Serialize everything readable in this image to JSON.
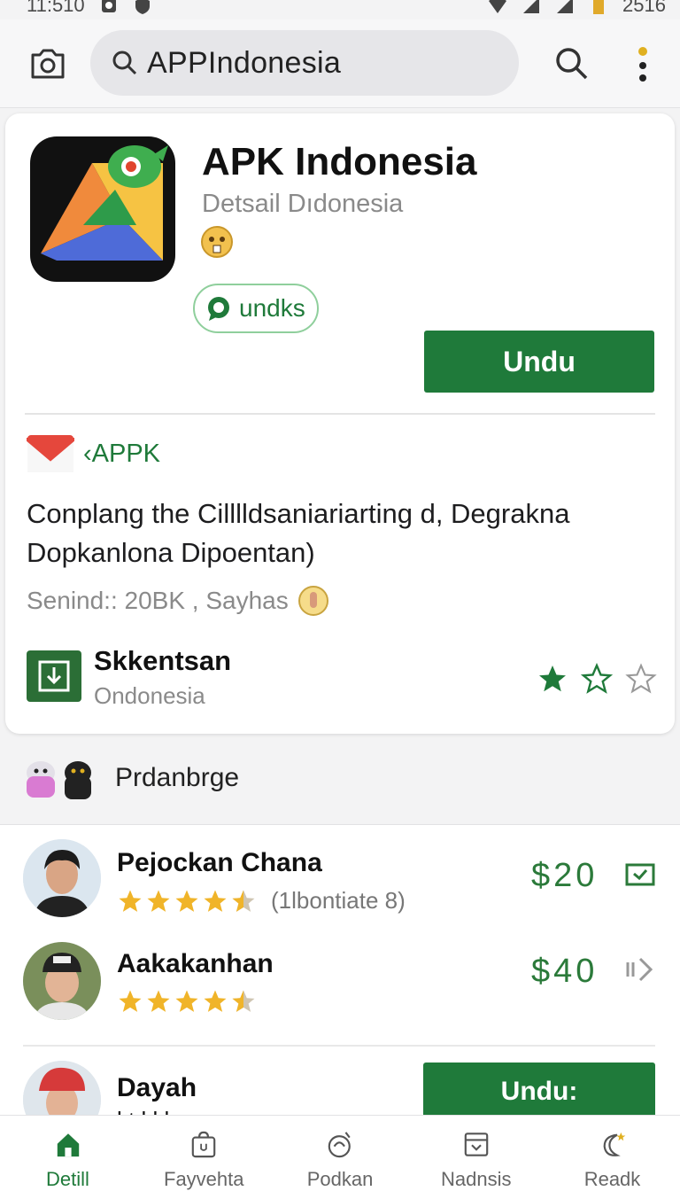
{
  "status_bar": {
    "time": "11:510",
    "battery": "2516"
  },
  "search": {
    "query": "APPIndonesia"
  },
  "app": {
    "title": "APK Indonesia",
    "subtitle": "Detsail Dıdonesia",
    "chip_label": "undks",
    "install_label": "Undu",
    "source_label": "‹APPK",
    "description": "Conplang the Cilllldsaniariarting d, Degrakna Dopkanlona Dipoentan)",
    "meta": "Senind:: 20BK , Sayhas",
    "developer_name": "Skkentsan",
    "developer_sub": "Ondonesia",
    "rating_stars": 1
  },
  "section": {
    "title": "Prdanbrge"
  },
  "list": [
    {
      "name": "Pejockan Chana",
      "rating": 4.5,
      "count": "(1lbontiate 8)",
      "price": "$20"
    },
    {
      "name": "Aakakanhan",
      "rating": 4.5,
      "count": "",
      "price": "$40"
    },
    {
      "name": "Dayah",
      "button_label": "Undu:",
      "sub": "l  t  l  l  l"
    }
  ],
  "nav": [
    {
      "label": "Detill",
      "icon": "home-icon",
      "active": true
    },
    {
      "label": "Fayvehta",
      "icon": "bag-icon",
      "active": false
    },
    {
      "label": "Podkan",
      "icon": "gamepad-icon",
      "active": false
    },
    {
      "label": "Nadnsis",
      "icon": "inbox-icon",
      "active": false
    },
    {
      "label": "Readk",
      "icon": "moon-icon",
      "active": false
    }
  ],
  "colors": {
    "accent": "#1f7a3a",
    "star": "#f0b429"
  }
}
